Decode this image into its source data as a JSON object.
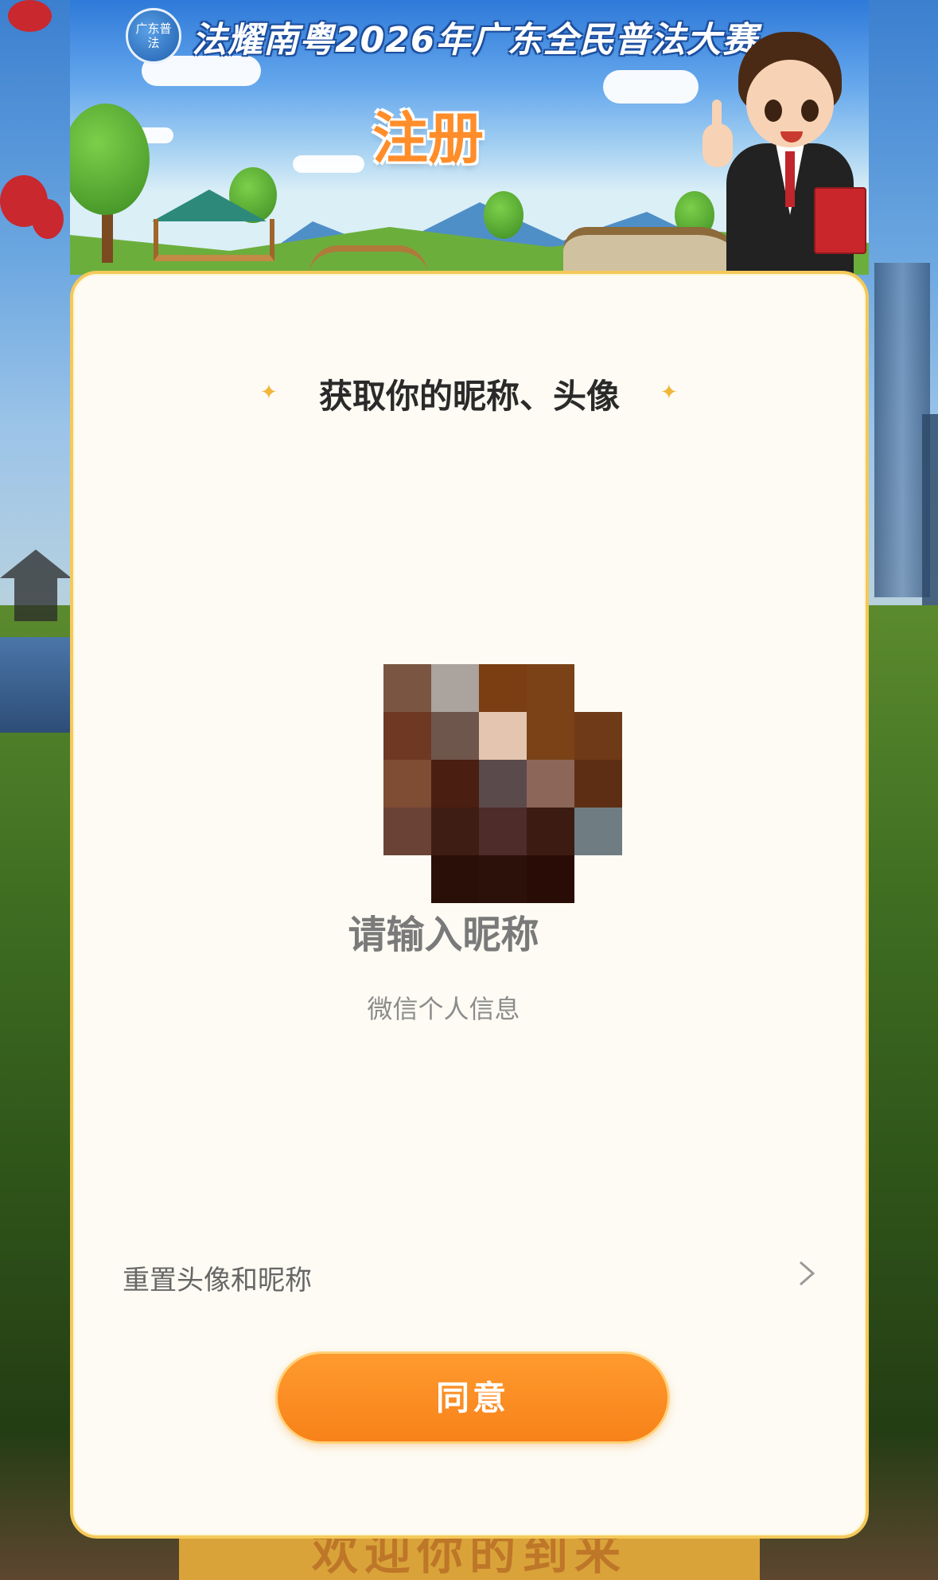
{
  "header": {
    "logo_text": "广东普法",
    "event_title": "法耀南粤2026年广东全民普法大赛",
    "page_heading": "注册"
  },
  "card": {
    "title": "获取你的昵称、头像",
    "nickname_placeholder": "请输入昵称",
    "subinfo": "微信个人信息",
    "reset_label": "重置头像和昵称",
    "agree_button": "同意"
  },
  "background": {
    "bottom_sign_text": "欢迎你的到来"
  },
  "icons": {
    "sparkle": "sparkle-icon",
    "chevron": "chevron-right-icon"
  },
  "colors": {
    "accent": "#f7821a",
    "card_border": "#f4c95a",
    "title_blue": "#1d4f9e"
  }
}
